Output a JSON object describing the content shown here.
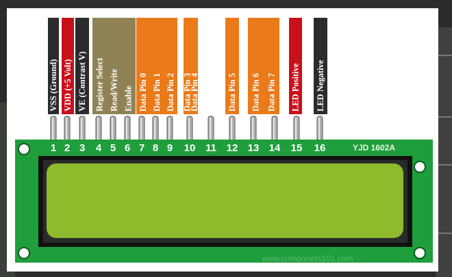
{
  "model_label": "YJD 1602A",
  "watermark": "www.componets101.com",
  "colors": {
    "black": "#2b2b2b",
    "red": "#c8101a",
    "olive": "#8f8356",
    "orange": "#ea7a1a",
    "pcb": "#1f9e3c",
    "lcd": "#8dbb2c"
  },
  "groups": [
    {
      "color": "black",
      "lines": [
        "VSS (Ground)"
      ]
    },
    {
      "color": "red",
      "lines": [
        "VDD (+5 Volt)"
      ]
    },
    {
      "color": "black",
      "lines": [
        "VE (Contrast V)"
      ]
    },
    {
      "color": "olive",
      "lines": [
        "Register Select",
        "Read/Write",
        "Enable"
      ]
    },
    {
      "color": "orange",
      "lines": [
        "Data Pin 0",
        "Data Pin 1",
        "Data Pin 2"
      ]
    },
    {
      "color": "orange",
      "lines": [
        "Data Pin 3",
        "Data Pin 4"
      ]
    },
    {
      "color": "orange",
      "lines": [
        "Data Pin 5"
      ]
    },
    {
      "color": "orange",
      "lines": [
        "Data Pin 6",
        "Data Pin 7"
      ]
    },
    {
      "color": "red",
      "lines": [
        "LED Positive"
      ]
    },
    {
      "color": "black",
      "lines": [
        "LED Negative"
      ]
    }
  ],
  "pins": [
    "1",
    "2",
    "3",
    "4",
    "5",
    "6",
    "7",
    "8",
    "9",
    "10",
    "11",
    "12",
    "13",
    "14",
    "15",
    "16"
  ]
}
